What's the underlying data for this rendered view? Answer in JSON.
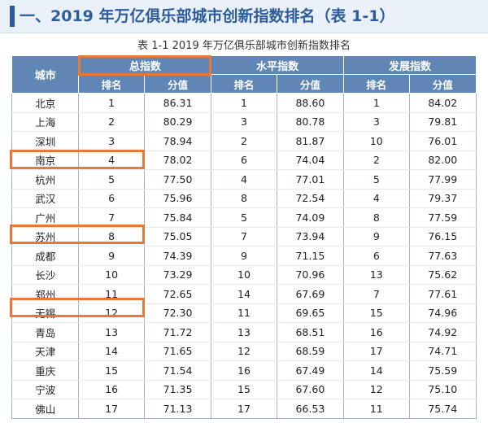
{
  "heading": "一、2019 年万亿俱乐部城市创新指数排名（表 1-1）",
  "caption": "表 1-1  2019 年万亿俱乐部城市创新指数排名",
  "columns": {
    "city": "城市",
    "groups": [
      "总指数",
      "水平指数",
      "发展指数"
    ],
    "rank": "排名",
    "score": "分值"
  },
  "highlight_color": "#e6783a",
  "header_color": "#5f86b4",
  "rows": [
    {
      "city": "北京",
      "total_rank": "1",
      "total_score": "86.31",
      "level_rank": "1",
      "level_score": "88.60",
      "dev_rank": "1",
      "dev_score": "84.02"
    },
    {
      "city": "上海",
      "total_rank": "2",
      "total_score": "80.29",
      "level_rank": "3",
      "level_score": "80.78",
      "dev_rank": "3",
      "dev_score": "79.81"
    },
    {
      "city": "深圳",
      "total_rank": "3",
      "total_score": "78.94",
      "level_rank": "2",
      "level_score": "81.87",
      "dev_rank": "10",
      "dev_score": "76.01"
    },
    {
      "city": "南京",
      "total_rank": "4",
      "total_score": "78.02",
      "level_rank": "6",
      "level_score": "74.04",
      "dev_rank": "2",
      "dev_score": "82.00"
    },
    {
      "city": "杭州",
      "total_rank": "5",
      "total_score": "77.50",
      "level_rank": "4",
      "level_score": "77.01",
      "dev_rank": "5",
      "dev_score": "77.99"
    },
    {
      "city": "武汉",
      "total_rank": "6",
      "total_score": "75.96",
      "level_rank": "8",
      "level_score": "72.54",
      "dev_rank": "4",
      "dev_score": "79.37"
    },
    {
      "city": "广州",
      "total_rank": "7",
      "total_score": "75.84",
      "level_rank": "5",
      "level_score": "74.09",
      "dev_rank": "8",
      "dev_score": "77.59"
    },
    {
      "city": "苏州",
      "total_rank": "8",
      "total_score": "75.05",
      "level_rank": "7",
      "level_score": "73.94",
      "dev_rank": "9",
      "dev_score": "76.15"
    },
    {
      "city": "成都",
      "total_rank": "9",
      "total_score": "74.39",
      "level_rank": "9",
      "level_score": "71.15",
      "dev_rank": "6",
      "dev_score": "77.63"
    },
    {
      "city": "长沙",
      "total_rank": "10",
      "total_score": "73.29",
      "level_rank": "10",
      "level_score": "70.96",
      "dev_rank": "13",
      "dev_score": "75.62"
    },
    {
      "city": "郑州",
      "total_rank": "11",
      "total_score": "72.65",
      "level_rank": "14",
      "level_score": "67.69",
      "dev_rank": "7",
      "dev_score": "77.61"
    },
    {
      "city": "无锡",
      "total_rank": "12",
      "total_score": "72.30",
      "level_rank": "11",
      "level_score": "69.65",
      "dev_rank": "15",
      "dev_score": "74.96"
    },
    {
      "city": "青岛",
      "total_rank": "13",
      "total_score": "71.72",
      "level_rank": "13",
      "level_score": "68.51",
      "dev_rank": "16",
      "dev_score": "74.92"
    },
    {
      "city": "天津",
      "total_rank": "14",
      "total_score": "71.65",
      "level_rank": "12",
      "level_score": "68.59",
      "dev_rank": "17",
      "dev_score": "74.71"
    },
    {
      "city": "重庆",
      "total_rank": "15",
      "total_score": "71.54",
      "level_rank": "16",
      "level_score": "67.49",
      "dev_rank": "14",
      "dev_score": "75.59"
    },
    {
      "city": "宁波",
      "total_rank": "16",
      "total_score": "71.35",
      "level_rank": "15",
      "level_score": "67.60",
      "dev_rank": "12",
      "dev_score": "75.10"
    },
    {
      "city": "佛山",
      "total_rank": "17",
      "total_score": "71.13",
      "level_rank": "17",
      "level_score": "66.53",
      "dev_rank": "11",
      "dev_score": "75.74"
    }
  ]
}
